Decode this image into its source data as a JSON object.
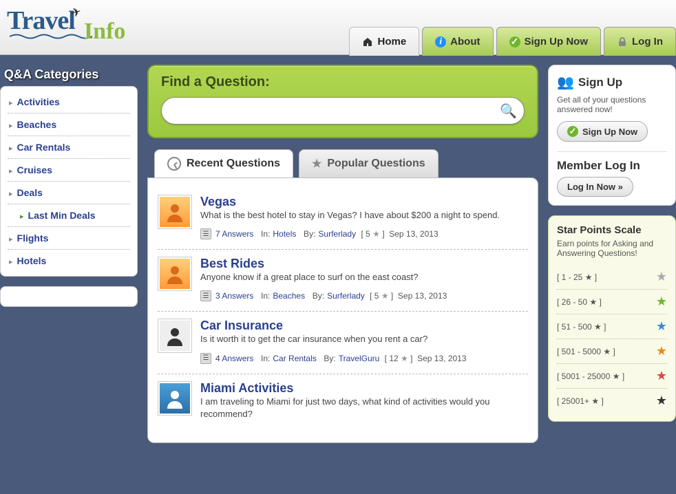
{
  "logo": {
    "travel": "Travel",
    "info": "Info"
  },
  "nav": {
    "home": "Home",
    "about": "About",
    "signup": "Sign Up Now",
    "login": "Log In"
  },
  "sidebar": {
    "title": "Q&A Categories",
    "items": [
      "Activities",
      "Beaches",
      "Car Rentals",
      "Cruises",
      "Deals",
      "Last Min Deals",
      "Flights",
      "Hotels"
    ]
  },
  "search": {
    "title": "Find a Question:",
    "placeholder": ""
  },
  "tabs": {
    "recent": "Recent Questions",
    "popular": "Popular Questions"
  },
  "questions": [
    {
      "title": "Vegas",
      "body": "What is the best hotel to stay in Vegas? I have about $200 a night to spend.",
      "answers": "7 Answers",
      "in_label": "In:",
      "category": "Hotels",
      "by_label": "By:",
      "author": "Surferlady",
      "stars": "5",
      "date": "Sep 13, 2013",
      "avatar": "orange"
    },
    {
      "title": "Best Rides",
      "body": "Anyone know if a great place to surf on the east coast?",
      "answers": "3 Answers",
      "in_label": "In:",
      "category": "Beaches",
      "by_label": "By:",
      "author": "Surferlady",
      "stars": "5",
      "date": "Sep 13, 2013",
      "avatar": "orange"
    },
    {
      "title": "Car Insurance",
      "body": "Is it worth it to get the car insurance when you rent a car?",
      "answers": "4 Answers",
      "in_label": "In:",
      "category": "Car Rentals",
      "by_label": "By:",
      "author": "TravelGuru",
      "stars": "12",
      "date": "Sep 13, 2013",
      "avatar": "dark"
    },
    {
      "title": "Miami Activities",
      "body": "I am traveling to Miami for just two days, what kind of activities would you recommend?",
      "answers": "",
      "in_label": "",
      "category": "",
      "by_label": "",
      "author": "",
      "stars": "",
      "date": "",
      "avatar": "photo"
    }
  ],
  "signup_box": {
    "title": "Sign Up",
    "text": "Get all of your questions answered now!",
    "button": "Sign Up Now",
    "login_title": "Member Log In",
    "login_button": "Log In Now »"
  },
  "scale": {
    "title": "Star Points Scale",
    "text": "Earn points for Asking and Answering Questions!",
    "rows": [
      {
        "label": "[ 1 - 25 ★ ]",
        "color": "st-gray"
      },
      {
        "label": "[ 26 - 50 ★ ]",
        "color": "st-green"
      },
      {
        "label": "[ 51 - 500 ★ ]",
        "color": "st-blue"
      },
      {
        "label": "[ 501 - 5000 ★ ]",
        "color": "st-orange"
      },
      {
        "label": "[ 5001 - 25000 ★ ]",
        "color": "st-red"
      },
      {
        "label": "[ 25001+ ★ ]",
        "color": "st-black"
      }
    ]
  }
}
